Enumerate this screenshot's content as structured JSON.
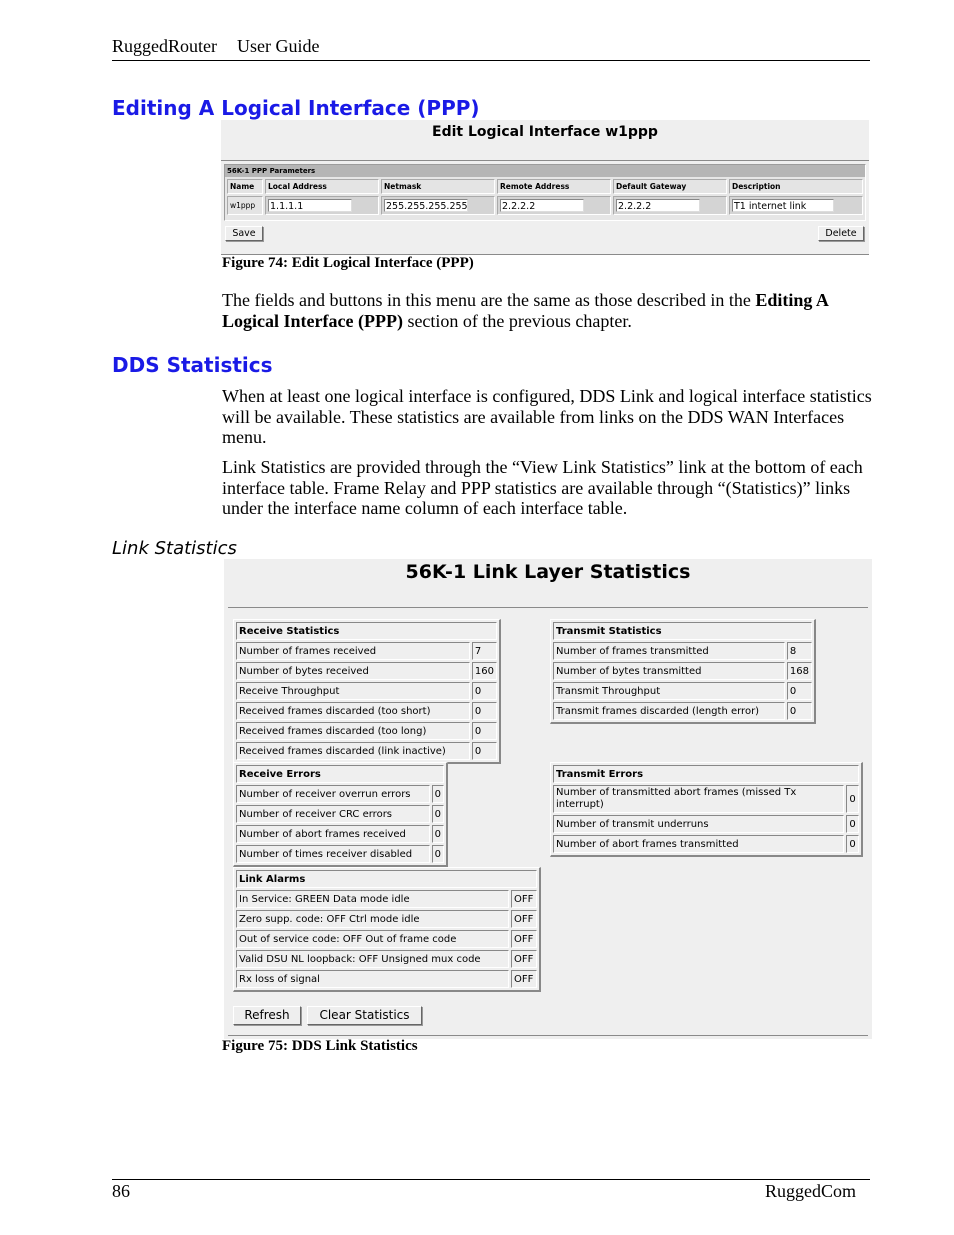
{
  "header": {
    "product": "RuggedRouter",
    "doc_title": "User Guide"
  },
  "section_ppp": {
    "heading": "Editing A Logical Interface (PPP)",
    "screen": {
      "title": "Edit Logical Interface w1ppp",
      "table_title": "56K-1 PPP Parameters",
      "columns": [
        "Name",
        "Local Address",
        "Netmask",
        "Remote Address",
        "Default Gateway",
        "Description"
      ],
      "row": {
        "name": "w1ppp",
        "local_address": "1.1.1.1",
        "netmask": "255.255.255.255",
        "remote_address": "2.2.2.2",
        "default_gateway": "2.2.2.2",
        "description": "T1 internet link"
      },
      "save_label": "Save",
      "delete_label": "Delete"
    },
    "caption": "Figure 74: Edit Logical Interface (PPP)",
    "para_pre": "The fields and buttons in this menu are the same as those described in the ",
    "para_bold": "Editing A Logical Interface (PPP)",
    "para_post": " section of the previous chapter."
  },
  "section_dds": {
    "heading": "DDS Statistics",
    "para1": "When at least one logical interface is configured, DDS Link and logical interface statistics will be available.  These statistics are available from links on the DDS WAN Interfaces menu.",
    "para2": "Link Statistics are provided through the “View Link Statistics” link at the bottom of each interface table.  Frame Relay and PPP statistics are available through “(Statistics)” links under the interface name column of each interface table.",
    "subheading": "Link Statistics",
    "screen": {
      "title": "56K-1 Link Layer Statistics",
      "receive_statistics": {
        "title": "Receive Statistics",
        "rows": [
          {
            "label": "Number of frames received",
            "value": "7"
          },
          {
            "label": "Number of bytes received",
            "value": "160"
          },
          {
            "label": "Receive Throughput",
            "value": "0"
          },
          {
            "label": "Received frames discarded (too short)",
            "value": "0"
          },
          {
            "label": "Received frames discarded (too long)",
            "value": "0"
          },
          {
            "label": "Received frames discarded (link inactive)",
            "value": "0"
          }
        ]
      },
      "transmit_statistics": {
        "title": "Transmit Statistics",
        "rows": [
          {
            "label": "Number of frames transmitted",
            "value": "8"
          },
          {
            "label": "Number of bytes transmitted",
            "value": "168"
          },
          {
            "label": "Transmit Throughput",
            "value": "0"
          },
          {
            "label": "Transmit frames discarded (length error)",
            "value": "0"
          }
        ]
      },
      "receive_errors": {
        "title": "Receive Errors",
        "rows": [
          {
            "label": "Number of receiver overrun errors",
            "value": "0"
          },
          {
            "label": "Number of receiver CRC errors",
            "value": "0"
          },
          {
            "label": "Number of abort frames received",
            "value": "0"
          },
          {
            "label": "Number of times receiver disabled",
            "value": "0"
          }
        ]
      },
      "transmit_errors": {
        "title": "Transmit Errors",
        "rows": [
          {
            "label": "Number of transmitted abort frames (missed Tx interrupt)",
            "value": "0"
          },
          {
            "label": "Number of transmit underruns",
            "value": "0"
          },
          {
            "label": "Number of abort frames transmitted",
            "value": "0"
          }
        ]
      },
      "link_alarms": {
        "title": "Link Alarms",
        "rows": [
          {
            "label": "In Service: GREEN Data mode idle",
            "value": "OFF"
          },
          {
            "label": "Zero supp. code: OFF Ctrl mode idle",
            "value": "OFF"
          },
          {
            "label": "Out of service code: OFF Out of frame code",
            "value": "OFF"
          },
          {
            "label": "Valid DSU NL loopback: OFF Unsigned mux code",
            "value": "OFF"
          },
          {
            "label": "Rx loss of signal",
            "value": "OFF"
          }
        ]
      },
      "refresh_label": "Refresh",
      "clear_label": "Clear Statistics"
    },
    "caption": "Figure 75: DDS Link Statistics"
  },
  "footer": {
    "page_number": "86",
    "company": "RuggedCom"
  },
  "colors": {
    "heading_blue": "#1a1ae6",
    "panel_bg": "#efefef"
  }
}
